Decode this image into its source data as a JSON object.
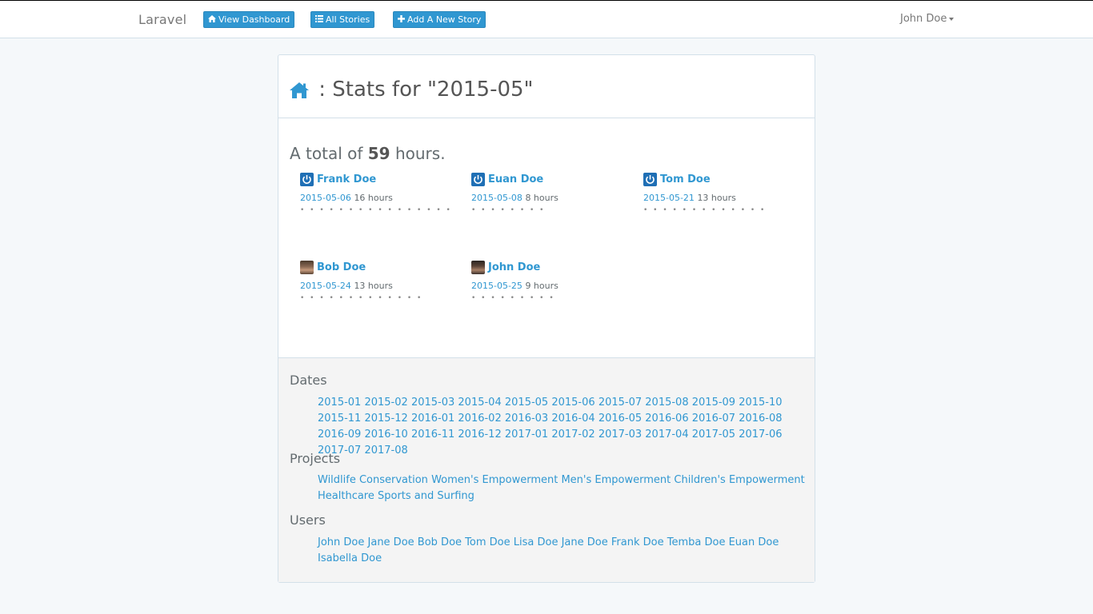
{
  "navbar": {
    "brand": "Laravel",
    "buttons": [
      {
        "label": "View Dashboard",
        "icon": "home-icon"
      },
      {
        "label": "All Stories",
        "icon": "list-icon"
      },
      {
        "label": "Add A New Story",
        "icon": "plus-icon"
      }
    ],
    "user": "John Doe"
  },
  "panel": {
    "title": ": Stats for \"2015-05\"",
    "total_prefix": "A total of",
    "total_hours": "59",
    "total_suffix": "hours.",
    "users": [
      {
        "name": "Frank Doe",
        "date": "2015-05-06",
        "hours": "16 hours",
        "dots": "• • • • • • • • • • • • • • • •",
        "avatar": "power-icon"
      },
      {
        "name": "Euan Doe",
        "date": "2015-05-08",
        "hours": "8 hours",
        "dots": "• • • • • • • •",
        "avatar": "power-icon"
      },
      {
        "name": "Tom Doe",
        "date": "2015-05-21",
        "hours": "13 hours",
        "dots": "• • • • • • • • • • • • •",
        "avatar": "power-icon"
      },
      {
        "name": "Bob Doe",
        "date": "2015-05-24",
        "hours": "13 hours",
        "dots": "• • • • • • • • • • • • •",
        "avatar": "photo"
      },
      {
        "name": "John Doe",
        "date": "2015-05-25",
        "hours": "9 hours",
        "dots": "• • • • • • • • •",
        "avatar": "photo"
      }
    ]
  },
  "footer": {
    "dates_title": "Dates",
    "dates": [
      "2015-01",
      "2015-02",
      "2015-03",
      "2015-04",
      "2015-05",
      "2015-06",
      "2015-07",
      "2015-08",
      "2015-09",
      "2015-10",
      "2015-11",
      "2015-12",
      "2016-01",
      "2016-02",
      "2016-03",
      "2016-04",
      "2016-05",
      "2016-06",
      "2016-07",
      "2016-08",
      "2016-09",
      "2016-10",
      "2016-11",
      "2016-12",
      "2017-01",
      "2017-02",
      "2017-03",
      "2017-04",
      "2017-05",
      "2017-06",
      "2017-07",
      "2017-08"
    ],
    "projects_title": "Projects",
    "projects": [
      "Wildlife Conservation",
      "Women's Empowerment",
      "Men's Empowerment",
      "Children's Empowerment",
      "Healthcare",
      "Sports and Surfing"
    ],
    "users_title": "Users",
    "users": [
      "John Doe",
      "Jane Doe",
      "Bob Doe",
      "Tom Doe",
      "Lisa Doe",
      "Jane Doe",
      "Frank Doe",
      "Temba Doe",
      "Euan Doe",
      "Isabella Doe"
    ]
  },
  "colors": {
    "accent": "#3097d1",
    "background": "#f5f8fa",
    "footer": "#f4f4f4"
  }
}
